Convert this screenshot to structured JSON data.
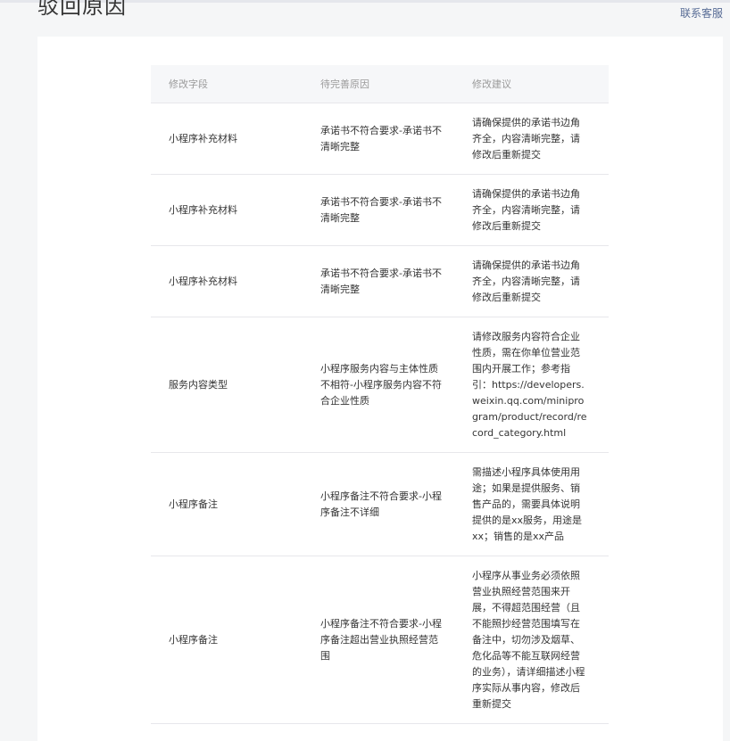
{
  "page": {
    "title": "驳回原因",
    "contact_label": "联系客服"
  },
  "table": {
    "headers": [
      "修改字段",
      "待完善原因",
      "修改建议"
    ],
    "rows": [
      {
        "field": "小程序补充材料",
        "reason": "承诺书不符合要求-承诺书不清晰完整",
        "suggestion": "请确保提供的承诺书边角齐全，内容清晰完整，请修改后重新提交"
      },
      {
        "field": "小程序补充材料",
        "reason": "承诺书不符合要求-承诺书不清晰完整",
        "suggestion": "请确保提供的承诺书边角齐全，内容清晰完整，请修改后重新提交"
      },
      {
        "field": "小程序补充材料",
        "reason": "承诺书不符合要求-承诺书不清晰完整",
        "suggestion": "请确保提供的承诺书边角齐全，内容清晰完整，请修改后重新提交"
      },
      {
        "field": "服务内容类型",
        "reason": "小程序服务内容与主体性质不相符-小程序服务内容不符合企业性质",
        "suggestion": "请修改服务内容符合企业性质，需在你单位营业范围内开展工作；参考指引：https://developers.weixin.qq.com/miniprogram/product/record/record_category.html"
      },
      {
        "field": "小程序备注",
        "reason": "小程序备注不符合要求-小程序备注不详细",
        "suggestion": "需描述小程序具体使用用途；如果是提供服务、销售产品的，需要具体说明提供的是xx服务，用途是xx；销售的是xx产品"
      },
      {
        "field": "小程序备注",
        "reason": "小程序备注不符合要求-小程序备注超出营业执照经营范围",
        "suggestion": "小程序从事业务必须依照营业执照经营范围来开展，不得超范围经营（且不能照抄经营范围填写在备注中，切勿涉及烟草、危化品等不能互联网经营的业务），请详细描述小程序实际从事内容，修改后重新提交"
      }
    ]
  }
}
